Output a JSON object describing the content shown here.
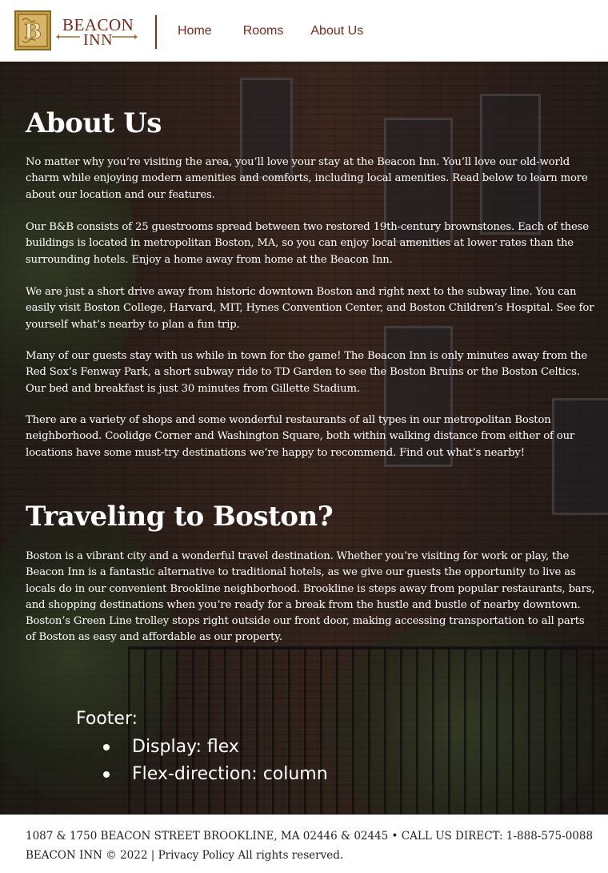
{
  "header": {
    "logo_line1": "BEACON",
    "logo_line2": "INN",
    "logo_monogram": "B",
    "nav": [
      {
        "label": "Home"
      },
      {
        "label": "Rooms"
      },
      {
        "label": "About Us"
      }
    ]
  },
  "about": {
    "heading": "About Us",
    "paragraphs": [
      "No matter why you’re visiting the area, you’ll love your stay at the Beacon Inn. You’ll love our old-world charm while enjoying modern amenities and comforts, including local amenities. Read below to learn more about our location and our features.",
      "Our B&B consists of 25 guestrooms spread between two restored 19th-century brownstones. Each of these buildings is located in metropolitan Boston, MA, so you can enjoy local amenities at lower rates than the surrounding hotels. Enjoy a home away from home at the Beacon Inn.",
      "We are just a short drive away from historic downtown Boston and right next to the subway line. You can easily visit Boston College, Harvard, MIT, Hynes Convention Center, and Boston Children’s Hospital. See for yourself what’s nearby to plan a fun trip.",
      "Many of our guests stay with us while in town for the game! The Beacon Inn is only minutes away from the Red Sox’s Fenway Park, a short subway ride to TD Garden to see the Boston Bruins or the Boston Celtics. Our bed and breakfast is just 30 minutes from Gillette Stadium.",
      "There are a variety of shops and some wonderful restaurants of all types in our metropolitan Boston neighborhood. Coolidge Corner and Washington Square, both within walking distance from either of our locations have some must-try destinations we’re happy to recommend. Find out what’s nearby!"
    ]
  },
  "travel": {
    "heading": "Traveling to Boston?",
    "paragraph": "Boston is a vibrant city and a wonderful travel destination. Whether you’re visiting for work or play, the Beacon Inn is a fantastic alternative to traditional hotels, as we give our guests the opportunity to live as locals do in our convenient Brookline neighborhood. Brookline is steps away from popular restaurants, bars, and shopping destinations when you’re ready for a break from the hustle and bustle of nearby downtown. Boston’s Green Line trolley stops right outside our front door, making accessing transportation to all parts of Boston as easy and affordable as our property."
  },
  "annotation": {
    "title": "Footer:",
    "items": [
      "Display: flex",
      "Flex-direction: column"
    ]
  },
  "footer": {
    "line1": "1087 & 1750 BEACON STREET BROOKLINE, MA 02446 & 02445 • CALL US DIRECT: 1-888-575-0088",
    "copyright": "BEACON INN © 2022 |",
    "privacy_link": "Privacy Policy",
    "rights": "All rights reserved."
  },
  "colors": {
    "brand": "#7a2a1a",
    "logo_gold": "#c9a04a",
    "overlay": "#1a1412"
  }
}
